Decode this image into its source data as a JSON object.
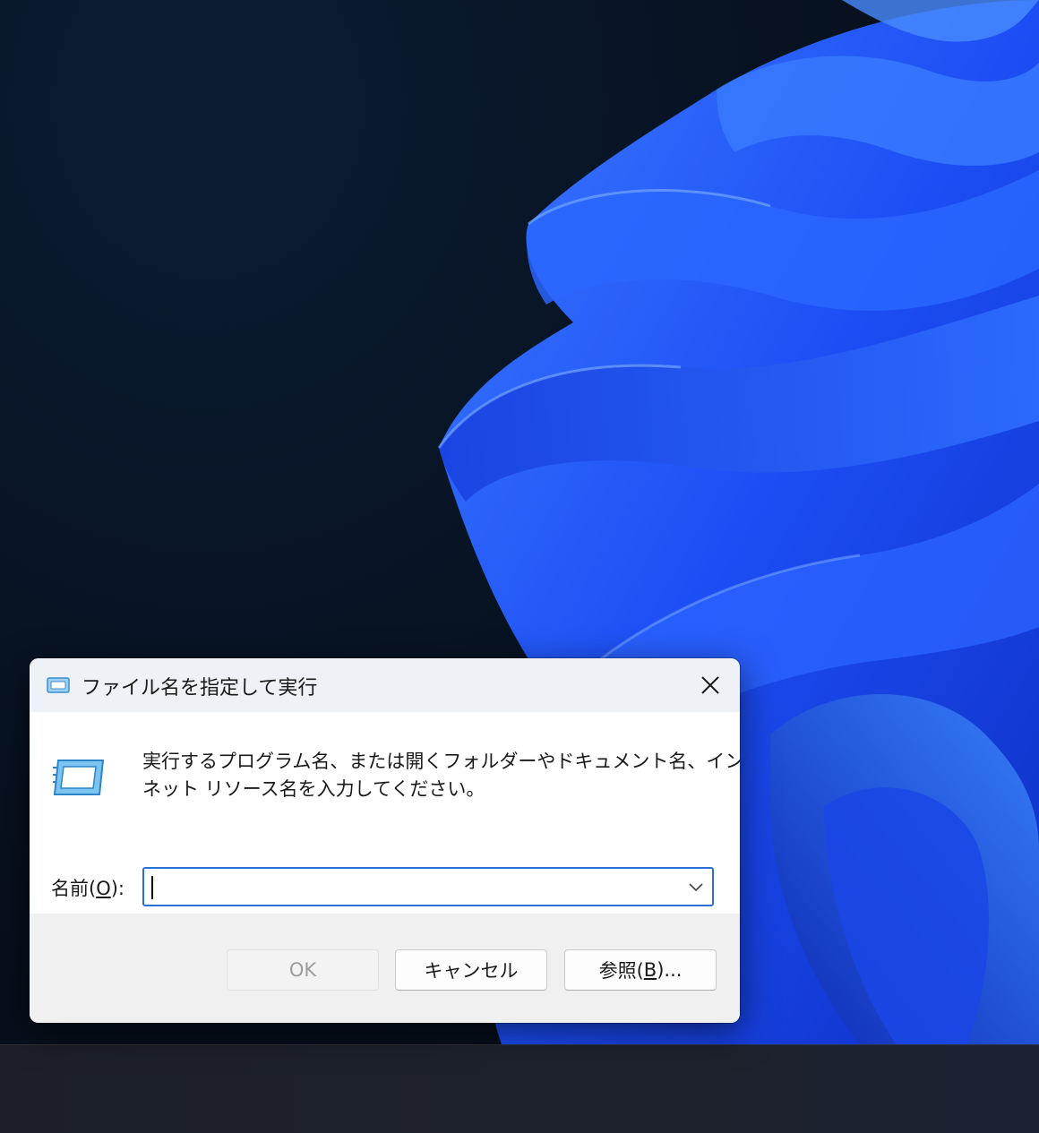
{
  "dialog": {
    "title": "ファイル名を指定して実行",
    "description_line1": "実行するプログラム名、または開くフォルダーやドキュメント名、インター",
    "description_line2": "ネット リソース名を入力してください。",
    "name_label_prefix": "名前(",
    "name_label_accel": "O",
    "name_label_suffix": "):",
    "input_value": "",
    "buttons": {
      "ok": "OK",
      "cancel": "キャンセル",
      "browse_prefix": "参照(",
      "browse_accel": "B",
      "browse_suffix": ")..."
    },
    "ok_disabled": true,
    "icons": {
      "title": "run-icon",
      "large": "run-icon",
      "close": "close-icon",
      "dropdown": "chevron-down-icon"
    }
  },
  "colors": {
    "accent": "#2a6fd6",
    "wallpaper_dark": "#07111f",
    "bloom_blue": "#1f52ff"
  }
}
